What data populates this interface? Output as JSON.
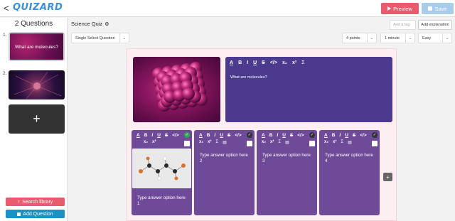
{
  "app": {
    "logo": "QUIZARD",
    "back_glyph": "<"
  },
  "toolbar": {
    "preview_label": "Preview",
    "save_label": "Save"
  },
  "sidebar": {
    "title": "2 Questions",
    "thumbnails": [
      {
        "number": "1.",
        "text": "What are molecules?"
      },
      {
        "number": "2.",
        "text": ""
      }
    ],
    "add_glyph": "+",
    "search_library_label": "Search library",
    "add_question_label": "Add Question"
  },
  "header": {
    "quiz_title": "Science Quiz",
    "tag_placeholder": "Add a tag",
    "add_explanation_label": "Add explanation",
    "question_type": "Single Select Question",
    "points": "4 points",
    "time": "1 minute",
    "difficulty": "Easy"
  },
  "editor": {
    "question_text": "What are molecules?",
    "toolbar_glyphs": [
      "A",
      "B",
      "I",
      "U",
      "S",
      "</>",
      "x₂",
      "x²",
      "Σ"
    ],
    "answers": [
      {
        "placeholder": "Type answer option here",
        "number": "1",
        "correct": true,
        "has_image": true
      },
      {
        "placeholder": "Type answer option here",
        "number": "2",
        "correct": false,
        "has_image": false
      },
      {
        "placeholder": "Type answer option here",
        "number": "3",
        "correct": false,
        "has_image": false
      },
      {
        "placeholder": "Type answer option here",
        "number": "4",
        "correct": false,
        "has_image": false
      }
    ],
    "add_option_glyph": "+"
  },
  "colors": {
    "accent_red": "#e85a6e",
    "accent_blue": "#1991c2",
    "question_panel": "#4b3a8e",
    "answer_panel": "#6e4a98",
    "correct_green": "#32a852"
  }
}
